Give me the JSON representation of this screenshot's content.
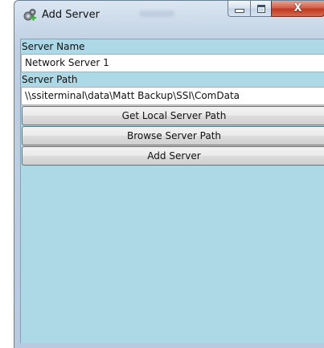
{
  "window": {
    "title": "Add Server",
    "icons": {
      "app": "server-add-icon",
      "minimize": "minimize-icon",
      "maximize": "maximize-icon",
      "close": "close-icon"
    },
    "close_glyph": "X"
  },
  "form": {
    "server_name_label": "Server Name",
    "server_name_value": "Network Server 1",
    "server_path_label": "Server Path",
    "server_path_value": "\\\\ssiterminal\\data\\Matt Backup\\SSI\\ComData"
  },
  "buttons": {
    "get_local_path": "Get Local Server Path",
    "browse_path": "Browse Server Path",
    "add_server": "Add Server"
  },
  "colors": {
    "client_background": "#add8e6",
    "close_button": "#c0391f"
  }
}
